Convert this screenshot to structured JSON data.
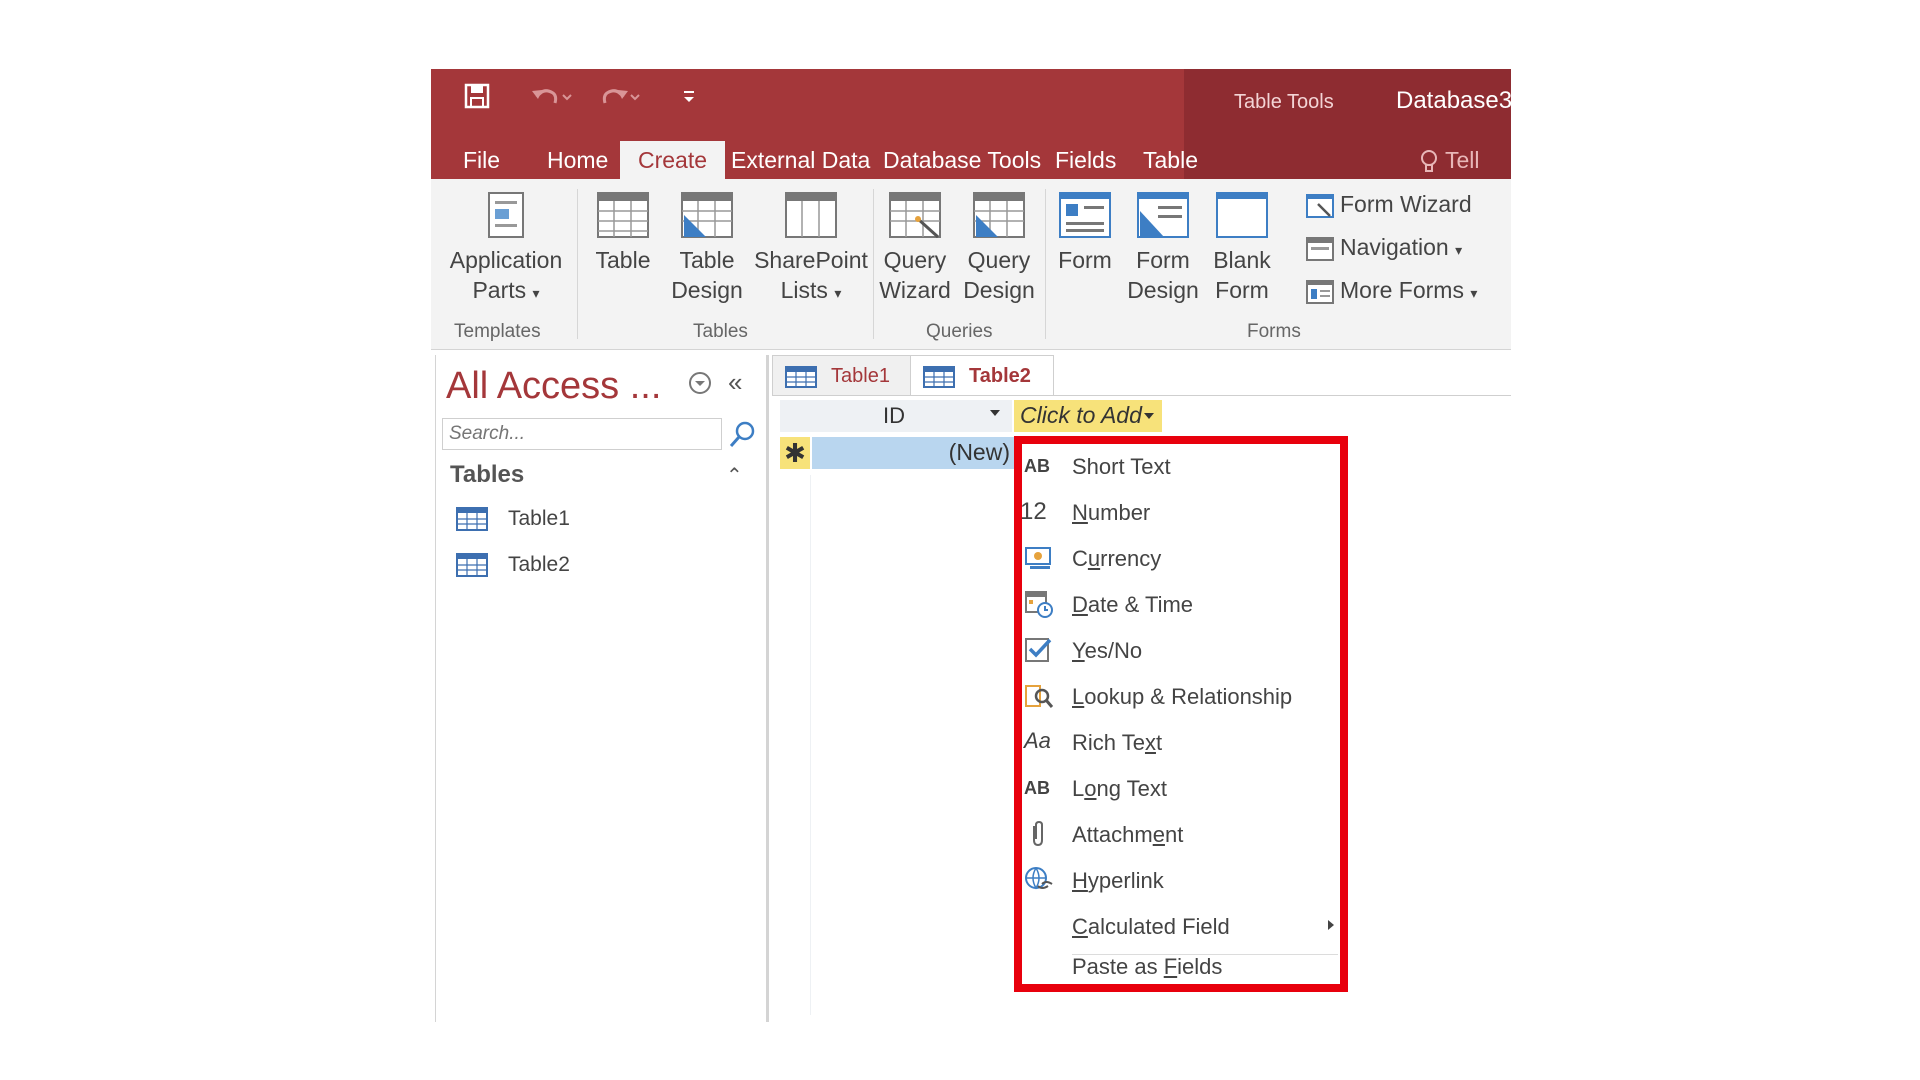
{
  "window": {
    "context_tab_group": "Table Tools",
    "db_title": "Database3"
  },
  "tabs": {
    "file": "File",
    "home": "Home",
    "create": "Create",
    "external": "External Data",
    "dbtools": "Database Tools",
    "fields": "Fields",
    "table": "Table",
    "tell": "Tell m"
  },
  "ribbon": {
    "app_parts_1": "Application",
    "app_parts_2": "Parts",
    "table": "Table",
    "table_design_1": "Table",
    "table_design_2": "Design",
    "sharepoint_1": "SharePoint",
    "sharepoint_2": "Lists",
    "query_wizard_1": "Query",
    "query_wizard_2": "Wizard",
    "query_design_1": "Query",
    "query_design_2": "Design",
    "form": "Form",
    "form_design_1": "Form",
    "form_design_2": "Design",
    "blank_form_1": "Blank",
    "blank_form_2": "Form",
    "form_wizard": "Form Wizard",
    "navigation": "Navigation",
    "more_forms": "More Forms",
    "group_templates": "Templates",
    "group_tables": "Tables",
    "group_queries": "Queries",
    "group_forms": "Forms"
  },
  "nav": {
    "title": "All Access ...",
    "search_placeholder": "Search...",
    "section": "Tables",
    "items": [
      "Table1",
      "Table2"
    ]
  },
  "doc_tabs": [
    "Table1",
    "Table2"
  ],
  "grid": {
    "id_header": "ID",
    "add_header": "Click to Add",
    "new_row_marker": "✱",
    "new_row_value": "(New)"
  },
  "menu": {
    "items": [
      {
        "icon": "AB",
        "pre": "",
        "u": "",
        "post": "Short Text",
        "underline_index": 0
      },
      {
        "icon": "12",
        "pre": "",
        "u": "N",
        "post": "umber"
      },
      {
        "icon": "currency",
        "pre": "C",
        "u": "u",
        "post": "rrency"
      },
      {
        "icon": "datetime",
        "pre": "",
        "u": "D",
        "post": "ate & Time"
      },
      {
        "icon": "check",
        "pre": "",
        "u": "Y",
        "post": "es/No"
      },
      {
        "icon": "lookup",
        "pre": "",
        "u": "L",
        "post": "ookup & Relationship"
      },
      {
        "icon": "Aa",
        "pre": "Rich Te",
        "u": "x",
        "post": "t"
      },
      {
        "icon": "AB",
        "pre": "L",
        "u": "o",
        "post": "ng Text"
      },
      {
        "icon": "clip",
        "pre": "Attachm",
        "u": "e",
        "post": "nt"
      },
      {
        "icon": "globe",
        "pre": "",
        "u": "H",
        "post": "yperlink"
      },
      {
        "icon": "",
        "pre": "",
        "u": "C",
        "post": "alculated Field"
      },
      {
        "icon": "",
        "pre": "Paste as ",
        "u": "F",
        "post": "ields"
      }
    ],
    "short_text_label": "Short Text"
  }
}
